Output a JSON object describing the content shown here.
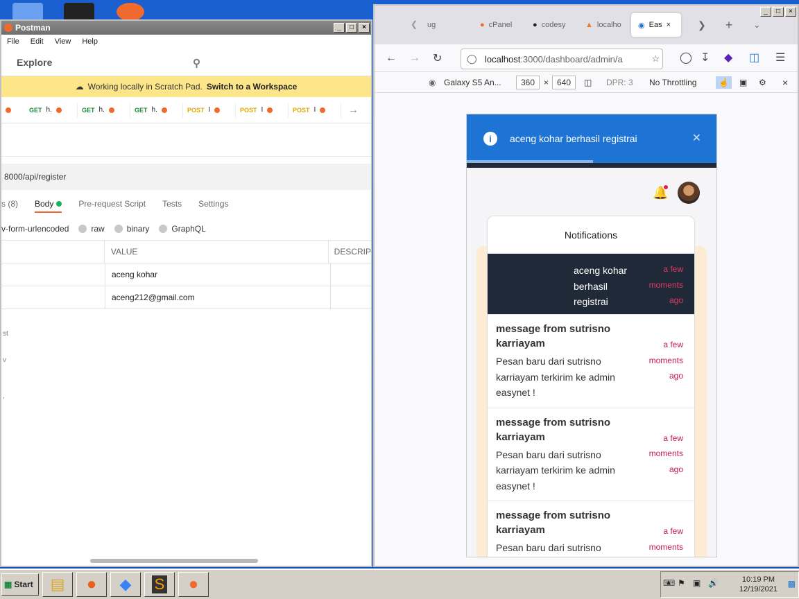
{
  "postman": {
    "title": "Postman",
    "menu": [
      "File",
      "Edit",
      "View",
      "Help"
    ],
    "explore": "Explore",
    "banner": {
      "text": "Working locally in Scratch Pad.",
      "link": "Switch to a Workspace"
    },
    "request_tabs": [
      {
        "method": "GET",
        "name": "h."
      },
      {
        "method": "GET",
        "name": "h."
      },
      {
        "method": "GET",
        "name": "h."
      },
      {
        "method": "POST",
        "name": "I"
      },
      {
        "method": "POST",
        "name": "I"
      },
      {
        "method": "POST",
        "name": "I"
      }
    ],
    "url": "8000/api/register",
    "subtabs": {
      "headers": "s (8)",
      "body": "Body",
      "prerequest": "Pre-request Script",
      "tests": "Tests",
      "settings": "Settings"
    },
    "body_types": {
      "urlencoded": "v-form-urlencoded",
      "raw": "raw",
      "binary": "binary",
      "graphql": "GraphQL"
    },
    "table": {
      "header_value": "VALUE",
      "header_desc": "DESCRIP",
      "rows": [
        "aceng kohar",
        "aceng212@gmail.com"
      ]
    },
    "fragments": [
      "st",
      "v",
      ","
    ]
  },
  "firefox": {
    "tabs": [
      "ug",
      "cPanel",
      "codesy",
      "localho",
      "Eas"
    ],
    "url_host": "localhost",
    "url_path": ":3000/dashboard/admin/a",
    "rdm": {
      "device": "Galaxy S5 An...",
      "width": "360",
      "x": "×",
      "height": "640",
      "dpr": "DPR: 3",
      "throttle": "No Throttling"
    }
  },
  "app": {
    "toast": "aceng kohar berhasil registrai",
    "notifications_title": "Notifications",
    "items": [
      {
        "text": "aceng kohar berhasil registrai",
        "time": "a few moments ago",
        "dark": true
      },
      {
        "title": "message from sutrisno karriayam",
        "body": "Pesan baru dari sutrisno karriayam terkirim ke admin easynet !",
        "time": "a few moments ago"
      },
      {
        "title": "message from sutrisno karriayam",
        "body": "Pesan baru dari sutrisno karriayam terkirim ke admin easynet !",
        "time": "a few moments ago"
      },
      {
        "title": "message from sutrisno karriayam",
        "body": "Pesan baru dari sutrisno karriayam terkirim ke admin",
        "time": "a few moments ago"
      }
    ]
  },
  "taskbar": {
    "start": "Start",
    "time": "10:19 PM",
    "date": "12/19/2021"
  }
}
